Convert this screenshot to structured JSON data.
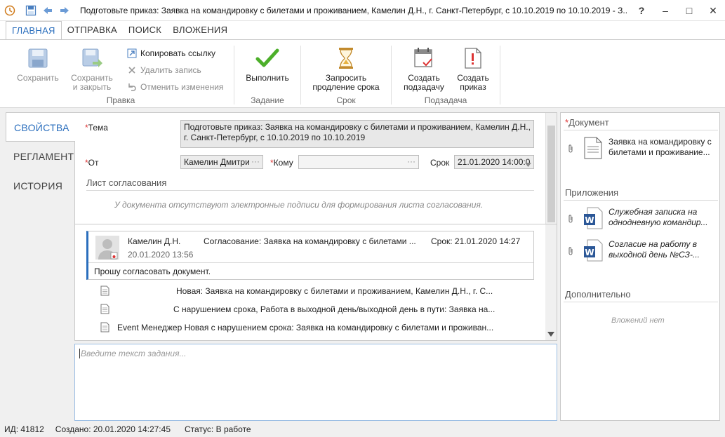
{
  "window": {
    "title": "Подготовьте приказ: Заявка на командировку с билетами и проживанием, Камелин Д.Н., г. Санкт-Петербург, с 10.10.2019 по 10.10.2019 - З...",
    "help": "?",
    "minimize": "–",
    "maximize": "□",
    "close": "✕"
  },
  "menu": {
    "tabs": [
      {
        "label": "ГЛАВНАЯ"
      },
      {
        "label": "ОТПРАВКА"
      },
      {
        "label": "ПОИСК"
      },
      {
        "label": "ВЛОЖЕНИЯ"
      }
    ]
  },
  "ribbon": {
    "save": "Сохранить",
    "save_close_1": "Сохранить",
    "save_close_2": "и закрыть",
    "copy_link": "Копировать ссылку",
    "delete_record": "Удалить запись",
    "undo_changes": "Отменить изменения",
    "group_edit": "Правка",
    "execute": "Выполнить",
    "group_task": "Задание",
    "extend_1": "Запросить",
    "extend_2": "продление срока",
    "group_term": "Срок",
    "subtask_1": "Создать",
    "subtask_2": "подзадачу",
    "order_1": "Создать",
    "order_2": "приказ",
    "group_subtask": "Подзадача"
  },
  "lefttabs": [
    {
      "label": "СВОЙСТВА"
    },
    {
      "label": "РЕГЛАМЕНТ"
    },
    {
      "label": "ИСТОРИЯ"
    }
  ],
  "form": {
    "subject_label": "Тема",
    "subject_value_1": "Подготовьте приказ: Заявка на командировку с билетами и проживанием, Камелин Д.Н.,",
    "subject_value_2": "г. Санкт-Петербург, с 10.10.2019 по 10.10.2019",
    "from_label": "От",
    "from_value": "Камелин Дмитри",
    "to_label": "Кому",
    "to_value": "",
    "term_label": "Срок",
    "term_value": "21.01.2020 14:00:0",
    "approval_title": "Лист согласования",
    "approval_hint": "У документа отсутствуют электронные подписи для формирования листа согласования.",
    "ellipsis": "···"
  },
  "comment": {
    "author": "Камелин Д.Н.",
    "subject": "Согласование: Заявка на командировку с билетами ...",
    "term": "Срок: 21.01.2020 14:27",
    "date": "20.01.2020 13:56",
    "text": "Прошу согласовать документ."
  },
  "history": [
    {
      "text": "Новая: Заявка на командировку с билетами и проживанием, Камелин Д.Н., г. С..."
    },
    {
      "text": "С нарушением срока, Работа в выходной день/выходной день в пути: Заявка на..."
    },
    {
      "text": "Event Менеджер Новая с нарушением срока: Заявка на командировку с билетами и проживан..."
    }
  ],
  "task": {
    "placeholder": "Введите текст задания..."
  },
  "rightpanel": {
    "document_title": "Документ",
    "document_name": "Заявка на командировку с билетами и проживание...",
    "attachments_title": "Приложения",
    "attachments": [
      {
        "name": "Служебная записка на однодневную командир..."
      },
      {
        "name": "Согласие на работу в выходной день №СЗ-..."
      }
    ],
    "extra_title": "Дополнительно",
    "extra_empty": "Вложений нет"
  },
  "status": {
    "id": "ИД: 41812",
    "created": "Создано: 20.01.2020 14:27:45",
    "state": "Статус: В работе"
  },
  "colors": {
    "accent": "#2a6ebd",
    "required": "#d33333",
    "check": "#4caf2a"
  }
}
